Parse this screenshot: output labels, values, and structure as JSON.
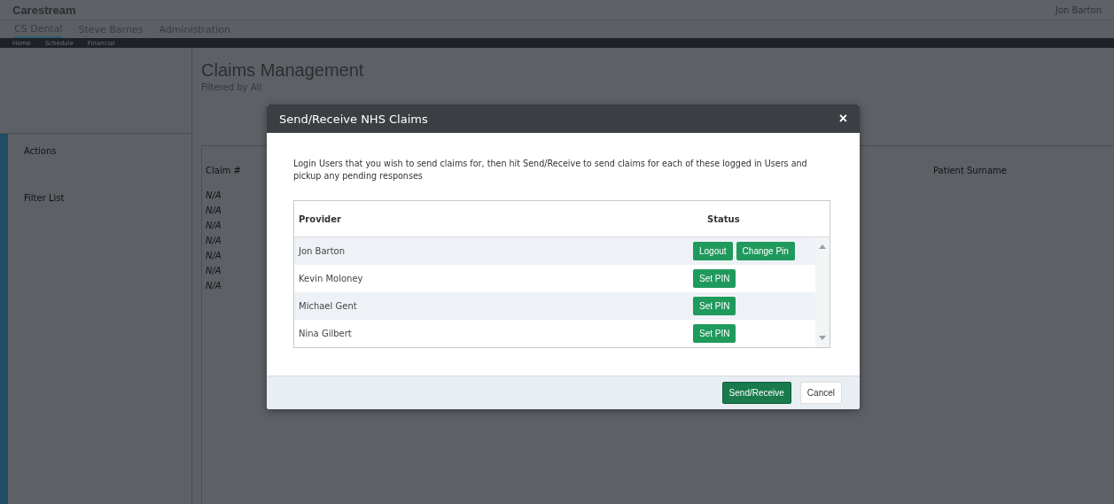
{
  "app": {
    "logo": "Carestream",
    "user": "Jon Barton"
  },
  "tabs": [
    {
      "label": "CS Dental",
      "selected": true
    },
    {
      "label": "Steve Barnes",
      "selected": false
    },
    {
      "label": "Administration",
      "selected": false
    }
  ],
  "menu": [
    {
      "label": "Home",
      "selected": false
    },
    {
      "label": "Schedule",
      "selected": false
    },
    {
      "label": "Financial",
      "selected": false
    }
  ],
  "sidebar": {
    "sections": [
      "Actions",
      "Filter List"
    ]
  },
  "page": {
    "title": "Claims Management",
    "filter": "Filtered by All",
    "columns": [
      "Claim #",
      "Patient Surname"
    ],
    "claim_rows": [
      "N/A",
      "N/A",
      "N/A",
      "N/A",
      "N/A",
      "N/A",
      "N/A"
    ]
  },
  "dialog": {
    "title": "Send/Receive NHS Claims",
    "close": "×",
    "description": "Login Users that you wish to send claims for, then hit Send/Receive to send claims for each of these logged in Users and pickup any pending responses",
    "columns": [
      "Provider",
      "Status"
    ],
    "rows": [
      {
        "name": "Jon Barton",
        "actions": [
          "Logout",
          "Change Pin"
        ]
      },
      {
        "name": "Kevin Moloney",
        "actions": [
          "Set PIN"
        ]
      },
      {
        "name": "Michael Gent",
        "actions": [
          "Set PIN"
        ]
      },
      {
        "name": "Nina Gilbert",
        "actions": [
          "Set PIN"
        ]
      }
    ],
    "buttons": [
      {
        "label": "Send/Receive",
        "kind": "primary"
      },
      {
        "label": "Cancel",
        "kind": "plain"
      }
    ]
  }
}
